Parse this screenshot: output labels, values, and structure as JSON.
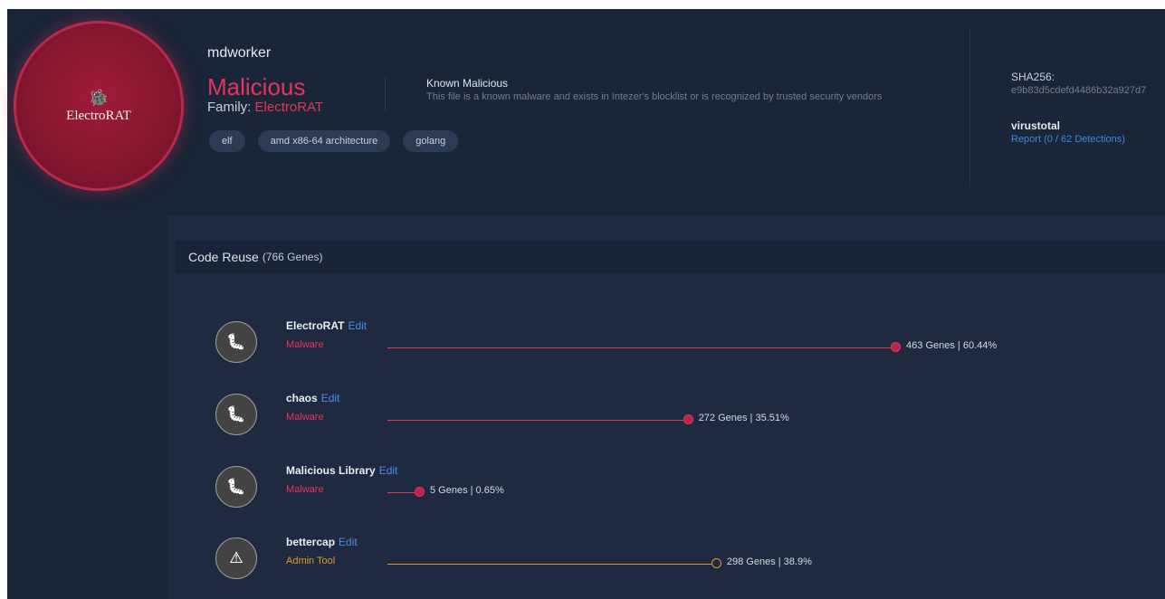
{
  "colors": {
    "malicious": "#e4355f",
    "admin_tool": "#e0962a",
    "link": "#4a8de8"
  },
  "badge": {
    "icon": "bug-icon",
    "name": "ElectroRAT"
  },
  "file": {
    "name": "mdworker",
    "verdict": "Malicious",
    "family_label": "Family:",
    "family_value": "ElectroRAT",
    "verdict_title": "Known Malicious",
    "verdict_desc": "This file is a known malware and exists in Intezer's blocklist or is recognized by trusted security vendors",
    "tags": [
      "elf",
      "amd x86-64 architecture",
      "golang"
    ]
  },
  "sidebar_info": {
    "sha_label": "SHA256:",
    "sha_value": "e9b83d5cdefd4486b32a927d7",
    "vt_label": "virustotal",
    "vt_link": "Report (0 / 62 Detections)"
  },
  "code_reuse": {
    "title": "Code Reuse",
    "count": "(766 Genes)",
    "edit_label": "Edit",
    "families": [
      {
        "name": "ElectroRAT",
        "type": "Malware",
        "genes": "463 Genes | 60.44%",
        "percent": 60.44,
        "icon": "bug-icon"
      },
      {
        "name": "chaos",
        "type": "Malware",
        "genes": "272 Genes | 35.51%",
        "percent": 35.51,
        "icon": "bug-icon"
      },
      {
        "name": "Malicious Library",
        "type": "Malware",
        "genes": "5 Genes | 0.65%",
        "percent": 0.65,
        "icon": "bug-icon"
      },
      {
        "name": "bettercap",
        "type": "Admin Tool",
        "genes": "298 Genes | 38.9%",
        "percent": 38.9,
        "icon": "warning-triangle-icon"
      }
    ]
  }
}
